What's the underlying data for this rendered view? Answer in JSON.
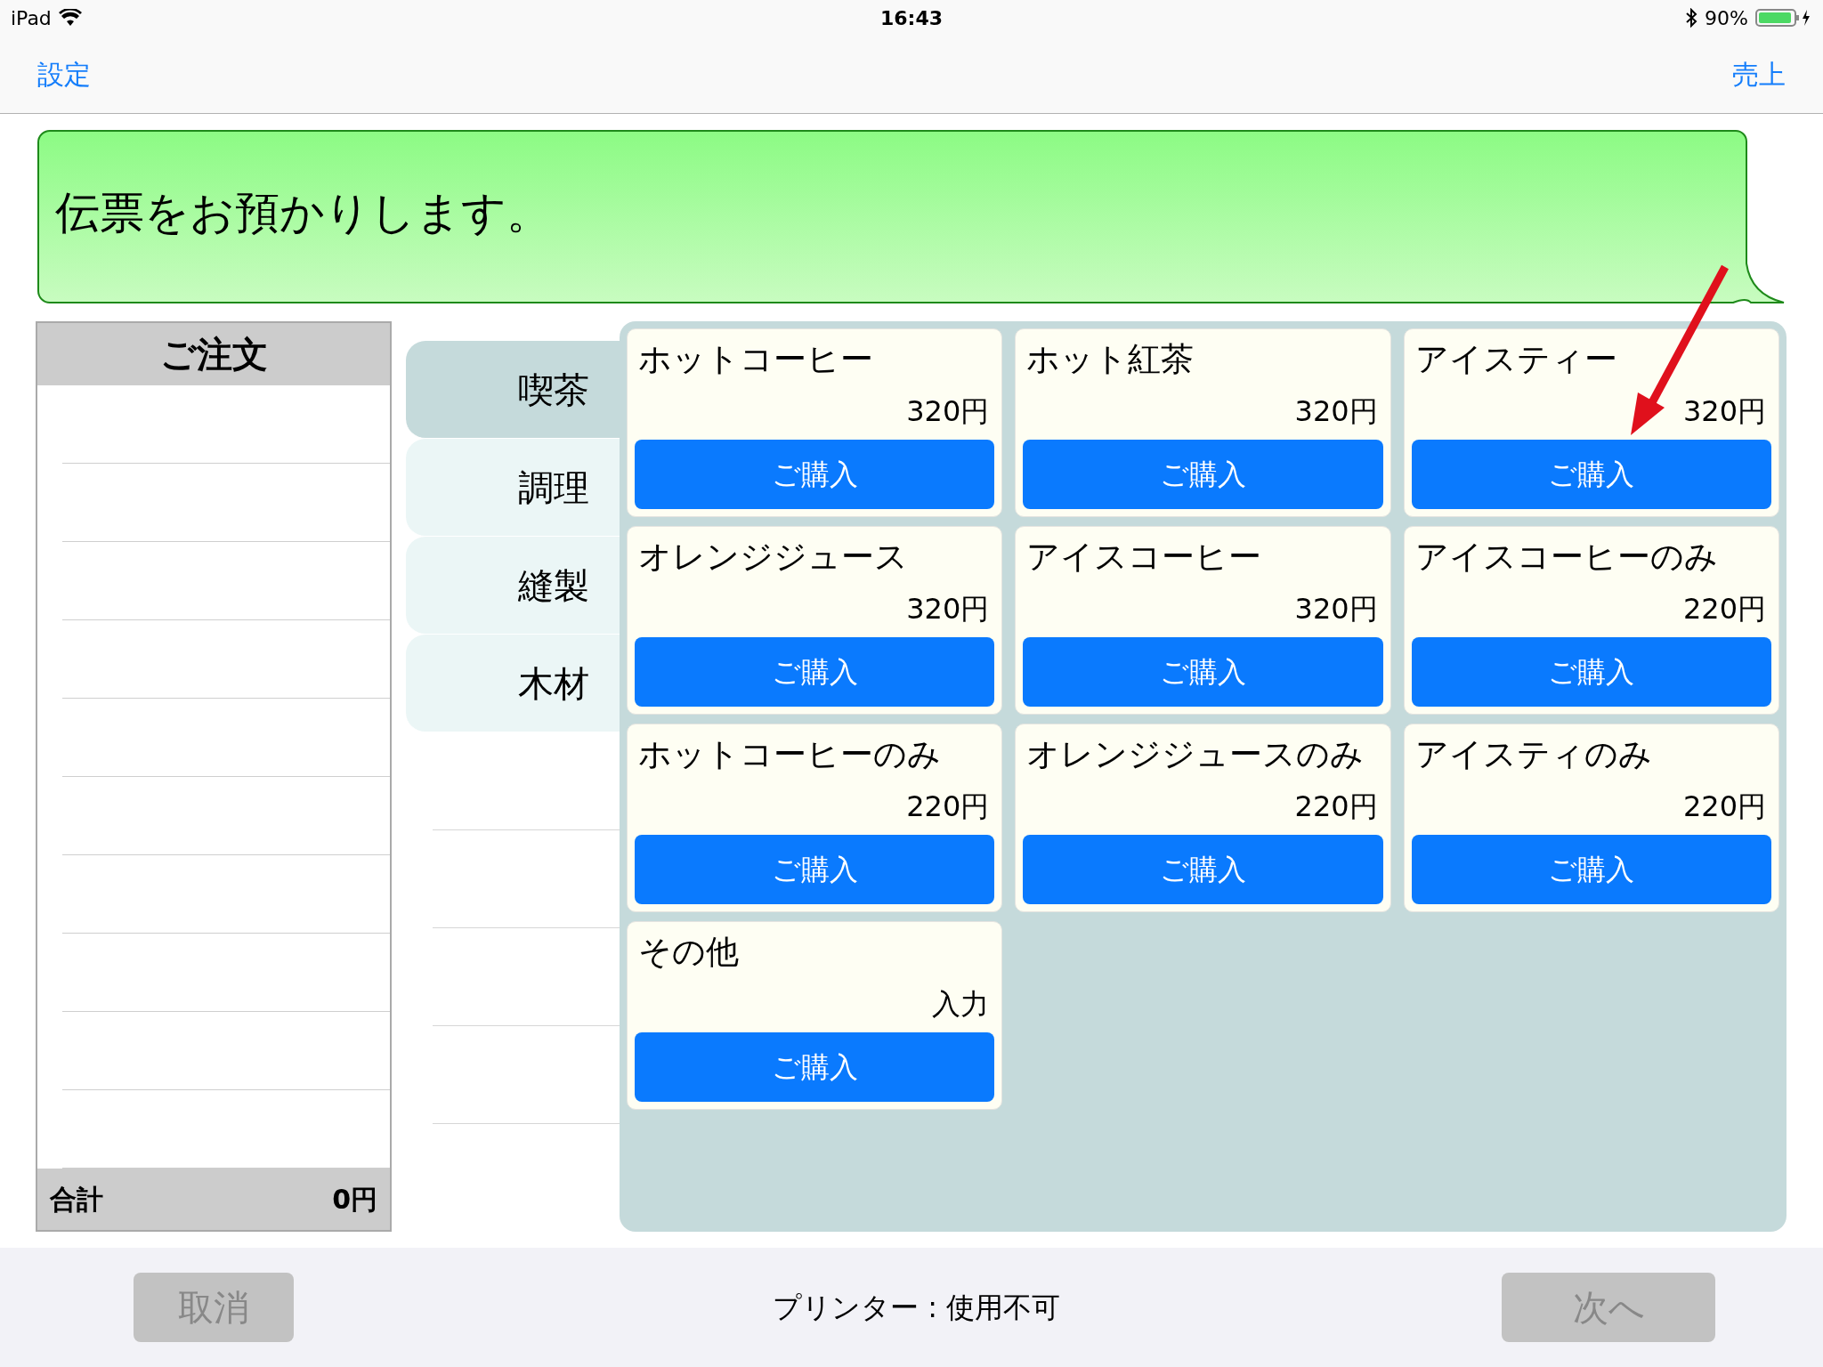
{
  "status_bar": {
    "device": "iPad",
    "time": "16:43",
    "battery": "90%"
  },
  "nav_bar": {
    "left": "設定",
    "right": "売上"
  },
  "message": "伝票をお預かりします。",
  "order": {
    "title": "ご注文",
    "total_label": "合計",
    "total": "0円"
  },
  "categories": [
    {
      "label": "喫茶",
      "selected": true
    },
    {
      "label": "調理",
      "selected": false
    },
    {
      "label": "縫製",
      "selected": false
    },
    {
      "label": "木材",
      "selected": false
    }
  ],
  "products": [
    {
      "name": "ホットコーヒー",
      "price": "320円",
      "button": "ご購入"
    },
    {
      "name": "ホット紅茶",
      "price": "320円",
      "button": "ご購入"
    },
    {
      "name": "アイスティー",
      "price": "320円",
      "button": "ご購入"
    },
    {
      "name": "オレンジジュース",
      "price": "320円",
      "button": "ご購入"
    },
    {
      "name": "アイスコーヒー",
      "price": "320円",
      "button": "ご購入"
    },
    {
      "name": "アイスコーヒーのみ",
      "price": "220円",
      "button": "ご購入"
    },
    {
      "name": "ホットコーヒーのみ",
      "price": "220円",
      "button": "ご購入"
    },
    {
      "name": "オレンジジュースのみ",
      "price": "220円",
      "button": "ご購入"
    },
    {
      "name": "アイスティのみ",
      "price": "220円",
      "button": "ご購入"
    },
    {
      "name": "その他",
      "price": "入力",
      "button": "ご購入"
    }
  ],
  "bottom_bar": {
    "cancel": {
      "label": "取消",
      "disabled": true
    },
    "printer_status": "プリンター : 使用不可",
    "next": {
      "label": "次へ",
      "disabled": true
    }
  }
}
